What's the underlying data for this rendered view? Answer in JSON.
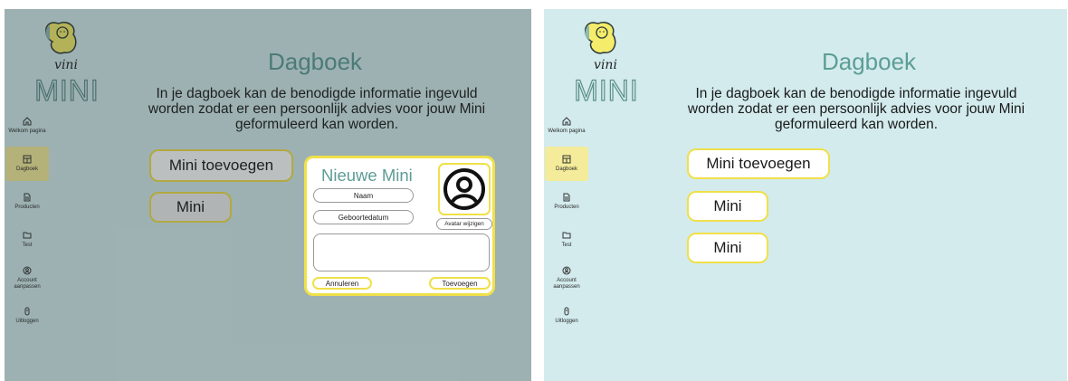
{
  "brand": {
    "logo_top": "vini",
    "logo_bottom": "MINI"
  },
  "nav": [
    {
      "label": "Welkom pagina",
      "icon": "home-icon"
    },
    {
      "label": "Dagboek",
      "icon": "journal-icon",
      "active": true
    },
    {
      "label": "Producten",
      "icon": "document-icon"
    },
    {
      "label": "Test",
      "icon": "folder-icon"
    },
    {
      "label": "Account aanpassen",
      "icon": "account-icon"
    },
    {
      "label": "Uitloggen",
      "icon": "logout-icon"
    }
  ],
  "page": {
    "title": "Dagboek",
    "intro": "In je dagboek kan de benodigde informatie ingevuld worden zodat er een persoonlijk advies voor jouw Mini geformuleerd kan worden."
  },
  "left": {
    "add_label": "Mini toevoegen",
    "minis": [
      "Mini"
    ]
  },
  "right": {
    "add_label": "Mini toevoegen",
    "minis": [
      "Mini",
      "Mini"
    ]
  },
  "dialog": {
    "title": "Nieuwe Mini",
    "name_placeholder": "Naam",
    "dob_placeholder": "Geboortedatum",
    "avatar_button": "Avatar wijzigen",
    "cancel": "Annuleren",
    "add": "Toevoegen"
  },
  "colors": {
    "background": "#d3ebed",
    "accent": "#f0e04a",
    "title": "#5d9d96",
    "active_nav": "#f4ec9a"
  }
}
